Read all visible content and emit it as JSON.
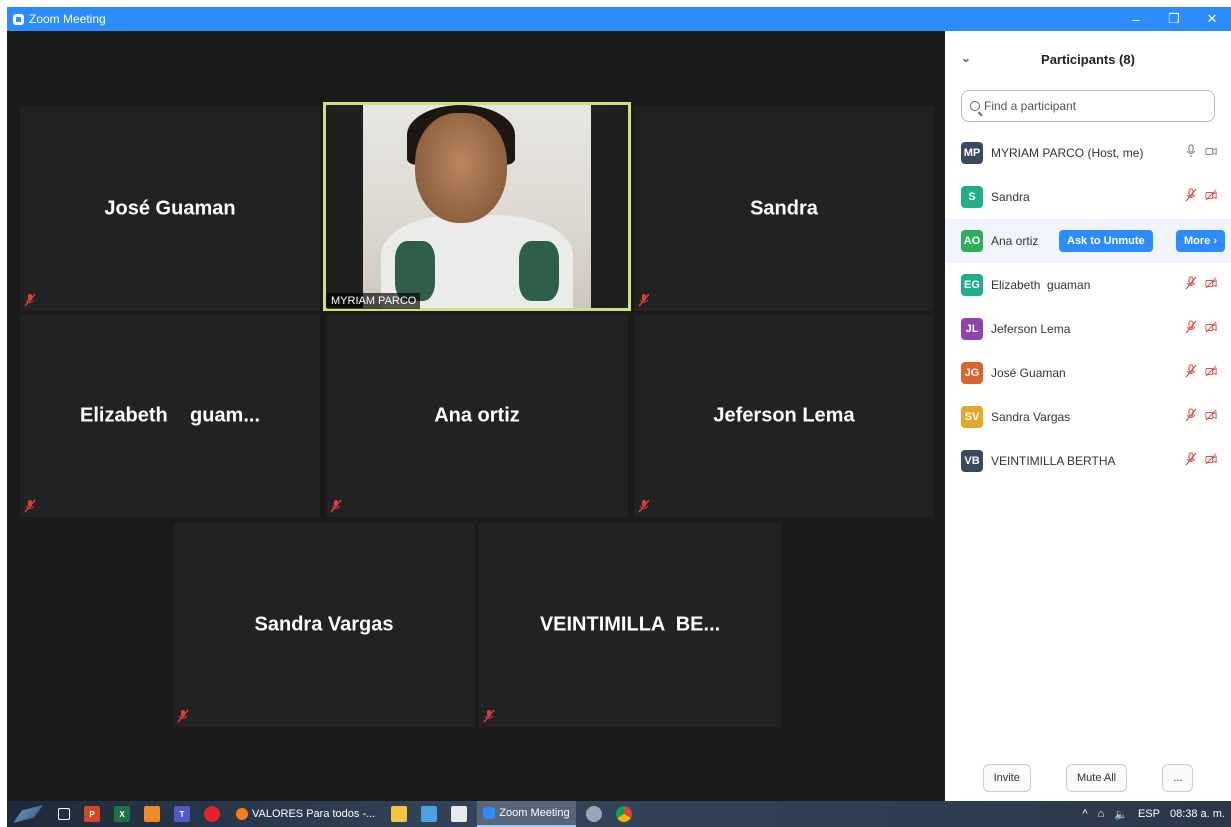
{
  "window": {
    "title": "Zoom Meeting",
    "controls": {
      "minimize": "–",
      "restore": "❐",
      "close": "✕"
    }
  },
  "gallery": {
    "tiles": [
      {
        "name": "José Guaman"
      },
      {
        "name": "MYRIAM PARCO",
        "video": true
      },
      {
        "name": "Sandra"
      },
      {
        "name": "Elizabeth    guam..."
      },
      {
        "name": "Ana ortiz"
      },
      {
        "name": "Jeferson Lema"
      },
      {
        "name": "Sandra Vargas"
      },
      {
        "name": "VEINTIMILLA  BE..."
      }
    ]
  },
  "participants": {
    "title": "Participants (8)",
    "search_placeholder": "Find a participant",
    "list": [
      {
        "initials": "MP",
        "color": "#3a4a5e",
        "name": "MYRIAM PARCO (Host, me)",
        "muted": false
      },
      {
        "initials": "S",
        "color": "#1fae8a",
        "name": "Sandra",
        "muted": true
      },
      {
        "initials": "AO",
        "color": "#2fae5a",
        "name": "Ana ortiz",
        "muted": true,
        "hover": true
      },
      {
        "initials": "EG",
        "color": "#1fae8a",
        "name": "Elizabeth  guaman",
        "muted": true
      },
      {
        "initials": "JL",
        "color": "#8e44ad",
        "name": "Jeferson Lema",
        "muted": true
      },
      {
        "initials": "JG",
        "color": "#d9652a",
        "name": "José Guaman",
        "muted": true
      },
      {
        "initials": "SV",
        "color": "#e3a82b",
        "name": "Sandra Vargas",
        "muted": true
      },
      {
        "initials": "VB",
        "color": "#3a4a5e",
        "name": "VEINTIMILLA BERTHA",
        "muted": true
      }
    ],
    "hover_actions": {
      "ask": "Ask to Unmute",
      "more": "More ›"
    },
    "footer": {
      "invite": "Invite",
      "mute_all": "Mute All",
      "more": "..."
    }
  },
  "taskbar": {
    "apps": [
      {
        "label": "VALORES Para todos -...",
        "color": "#ff7b1c"
      },
      {
        "label": "Zoom Meeting",
        "color": "#2d8cff",
        "active": true
      }
    ],
    "tray": {
      "lang": "ESP",
      "time": "08:38 a. m."
    }
  }
}
